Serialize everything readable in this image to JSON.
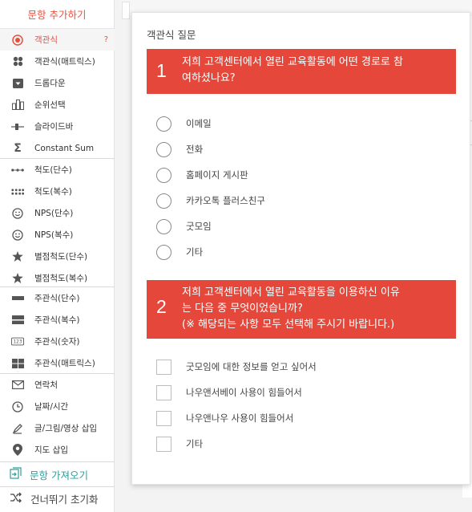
{
  "sidebar": {
    "title": "문항 추가하기",
    "help_mark": "?",
    "items": [
      {
        "label": "객관식",
        "icon": "radio-target-icon"
      },
      {
        "label": "객관식(매트릭스)",
        "icon": "grid-dots-icon"
      },
      {
        "label": "드롭다운",
        "icon": "dropdown-icon"
      },
      {
        "label": "순위선택",
        "icon": "rank-icon"
      },
      {
        "label": "슬라이드바",
        "icon": "slider-icon"
      },
      {
        "label": "Constant Sum",
        "icon": "sigma-icon"
      },
      {
        "label": "척도(단수)",
        "icon": "scale-single-icon"
      },
      {
        "label": "척도(복수)",
        "icon": "scale-multi-icon"
      },
      {
        "label": "NPS(단수)",
        "icon": "smiley-icon"
      },
      {
        "label": "NPS(복수)",
        "icon": "smiley-icon"
      },
      {
        "label": "별점척도(단수)",
        "icon": "star-icon"
      },
      {
        "label": "별점척도(복수)",
        "icon": "star-icon"
      },
      {
        "label": "주관식(단수)",
        "icon": "single-line-icon"
      },
      {
        "label": "주관식(복수)",
        "icon": "multi-line-icon"
      },
      {
        "label": "주관식(숫자)",
        "icon": "number-123-icon"
      },
      {
        "label": "주관식(매트릭스)",
        "icon": "grid-icon"
      },
      {
        "label": "연락처",
        "icon": "envelope-icon"
      },
      {
        "label": "날짜/시간",
        "icon": "clock-icon"
      },
      {
        "label": "글/그림/영상 삽입",
        "icon": "media-insert-icon"
      },
      {
        "label": "지도 삽입",
        "icon": "map-pin-icon"
      }
    ],
    "import_label": "문항 가져오기",
    "reset_label": "건너뛰기 초기화"
  },
  "popup": {
    "title": "객관식 질문",
    "questions": [
      {
        "number": "1",
        "lines": [
          "저희 고객센터에서 열린 교육활동에 어떤 경로로 참",
          "여하셨나요?"
        ],
        "options": [
          "이메일",
          "전화",
          "홈페이지 게시판",
          "카카오톡 플러스친구",
          "굿모임",
          "기타"
        ]
      },
      {
        "number": "2",
        "lines": [
          "저희 고객센터에서 열린 교육활동을 이용하신 이유",
          "는 다음 중 무엇이었습니까?",
          "(※ 해당되는 사항 모두 선택해 주시기 바랍니다.)"
        ],
        "options": [
          "굿모임에 대한 정보를 얻고 싶어서",
          "나우앤서베이 사용이 힘들어서",
          "나우앤나우 사용이 힘들어서",
          "기타"
        ]
      }
    ]
  },
  "colors": {
    "accent": "#e8503e",
    "question_bg": "#e5473a",
    "import": "#2e9e98"
  }
}
